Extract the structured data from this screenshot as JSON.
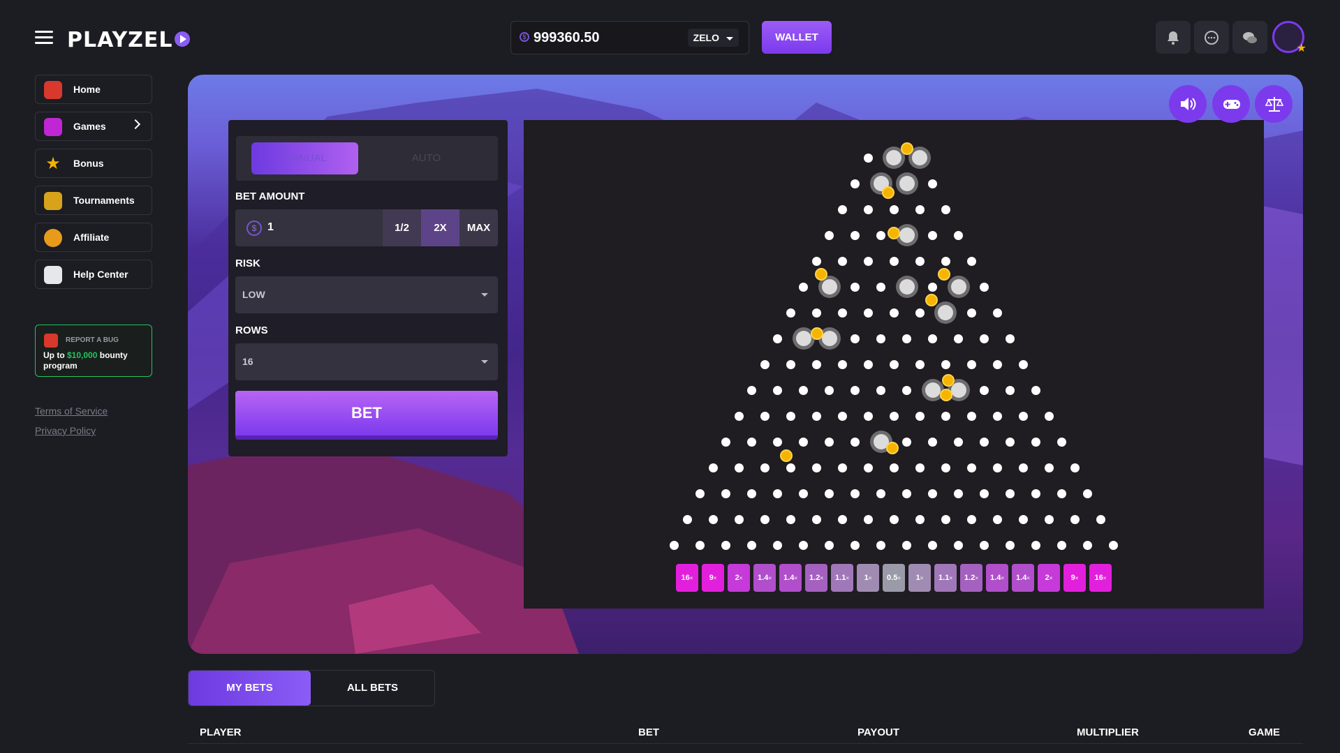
{
  "header": {
    "logo": "PLAYZEL",
    "balance": "999360.50",
    "currency": "ZELO",
    "wallet_label": "WALLET",
    "icons": [
      "bell-icon",
      "chat-icon",
      "messages-icon"
    ]
  },
  "sidebar": {
    "items": [
      {
        "label": "Home",
        "icon": "home-icon"
      },
      {
        "label": "Games",
        "icon": "gamepad-icon"
      },
      {
        "label": "Bonus",
        "icon": "star-icon"
      },
      {
        "label": "Tournaments",
        "icon": "trophy-icon"
      },
      {
        "label": "Affiliate",
        "icon": "coin-icon"
      },
      {
        "label": "Help Center",
        "icon": "megaphone-icon"
      }
    ],
    "bug_card": {
      "title": "REPORT A BUG",
      "line_prefix": "Up to",
      "amount": "$10,000",
      "line_suffix": "bounty program"
    },
    "terms": "Terms of Service",
    "privacy": "Privacy Policy"
  },
  "game": {
    "mode_tabs": [
      "MANUAL",
      "AUTO"
    ],
    "active_mode": "MANUAL",
    "bet_amount_label": "BET AMOUNT",
    "bet_amount_value": "1",
    "half_label": "1/2",
    "double_label": "2X",
    "max_label": "MAX",
    "risk_label": "RISK",
    "risk_value": "LOW",
    "rows_label": "ROWS",
    "rows_value": "16",
    "bet_label": "BET",
    "multipliers": [
      "16",
      "9",
      "2",
      "1.4",
      "1.4",
      "1.2",
      "1.1",
      "1",
      "0.5",
      "1",
      "1.1",
      "1.2",
      "1.4",
      "1.4",
      "2",
      "9",
      "16"
    ],
    "multiplier_suffix": "×",
    "colors": {
      "accent": "#7c3aed",
      "ball": "#f5b400",
      "high": "#e21fdc",
      "low": "#a8a0b8"
    }
  },
  "bets": {
    "tabs": [
      "MY BETS",
      "ALL BETS"
    ],
    "active_tab": "MY BETS",
    "columns": [
      "PLAYER",
      "BET",
      "PAYOUT",
      "MULTIPLIER",
      "GAME"
    ]
  }
}
